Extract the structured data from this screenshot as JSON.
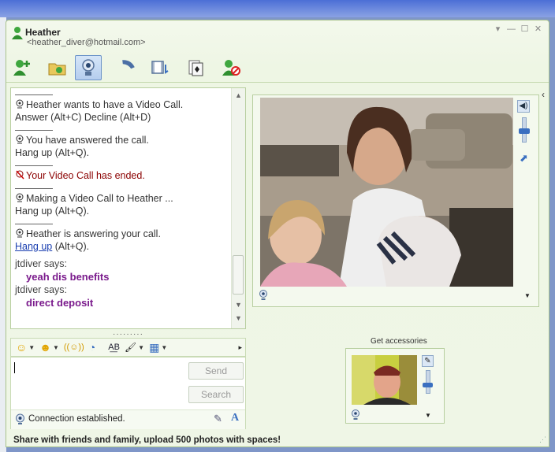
{
  "contact": {
    "name": "Heather",
    "email": "<heather_diver@hotmail.com>"
  },
  "window_controls": [
    "▾",
    "—",
    "☐",
    "✕"
  ],
  "toolbar": [
    {
      "icon": "invite-contact-icon"
    },
    {
      "icon": "send-files-icon"
    },
    {
      "icon": "webcam-icon",
      "active": true
    },
    {
      "icon": "phone-call-icon"
    },
    {
      "icon": "video-clip-icon"
    },
    {
      "icon": "games-icon"
    },
    {
      "icon": "block-contact-icon"
    }
  ],
  "chat": {
    "messages": [
      {
        "text": "Heather wants to have a Video Call.",
        "sub": "Answer (Alt+C)   Decline (Alt+D)"
      },
      {
        "text": "You have answered the call.",
        "sub": "Hang up (Alt+Q)."
      },
      {
        "text": "Your Video Call has ended.",
        "red": true
      },
      {
        "text": "Making a Video Call to Heather ...",
        "sub": "Hang up (Alt+Q)."
      },
      {
        "text": "Heather is answering your call.",
        "link": "Hang up",
        "link_suffix": " (Alt+Q)."
      }
    ],
    "says": [
      {
        "who": "jtdiver says:",
        "msg": "yeah dis benefits"
      },
      {
        "who": "jtdiver says:",
        "msg": "direct deposit"
      }
    ]
  },
  "emoticon_bar": {
    "items": [
      "emoticon-icon",
      "wink-icon",
      "nudge-icon",
      "voice-clip-icon",
      "font-icon",
      "background-icon",
      "more-icon"
    ],
    "glyphs": [
      "☺",
      "☻",
      "((☺))",
      "◔",
      "A͟B",
      "🖌",
      "▦"
    ]
  },
  "input": {
    "send_label": "Send",
    "search_label": "Search"
  },
  "status": {
    "text": "Connection established."
  },
  "accessories": {
    "label": "Get accessories"
  },
  "banner": {
    "text": "Share with friends and family, upload 500 photos with spaces!"
  },
  "colors": {
    "frame_green": "#a9c38c",
    "message_purple": "#7a1a8c",
    "ended_red": "#8b0000",
    "link_blue": "#1a3fb0"
  }
}
